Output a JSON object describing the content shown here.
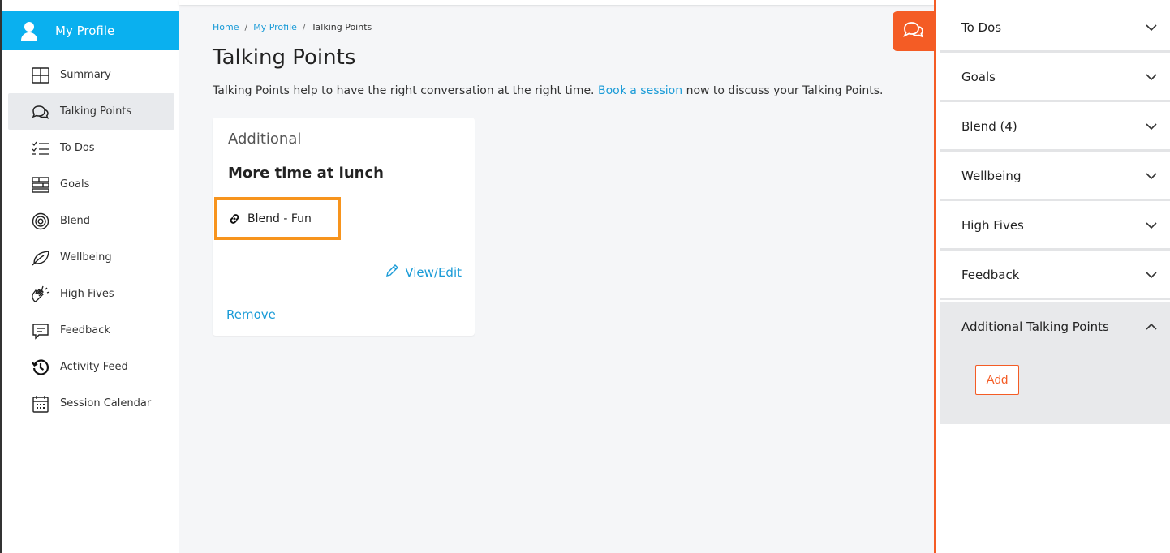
{
  "sidebar": {
    "profile_label": "My Profile",
    "items": [
      {
        "label": "Summary"
      },
      {
        "label": "Talking Points"
      },
      {
        "label": "To Dos"
      },
      {
        "label": "Goals"
      },
      {
        "label": "Blend"
      },
      {
        "label": "Wellbeing"
      },
      {
        "label": "High Fives"
      },
      {
        "label": "Feedback"
      },
      {
        "label": "Activity Feed"
      },
      {
        "label": "Session Calendar"
      }
    ],
    "active_item": "Talking Points"
  },
  "breadcrumb": {
    "home": "Home",
    "sep1": "/",
    "profile": "My Profile",
    "sep2": "/",
    "current": "Talking Points"
  },
  "main": {
    "title": "Talking Points",
    "intro_before": "Talking Points help to have the right conversation at the right time.",
    "intro_link": "Book a session",
    "intro_after": "now to discuss your Talking Points."
  },
  "card": {
    "category": "Additional",
    "title": "More time at lunch",
    "link_label": "Blend - Fun",
    "view_edit": "View/Edit",
    "remove": "Remove"
  },
  "rpanel": {
    "sections": [
      {
        "label": "To Dos"
      },
      {
        "label": "Goals"
      },
      {
        "label": "Blend (4)"
      },
      {
        "label": "Wellbeing"
      },
      {
        "label": "High Fives"
      },
      {
        "label": "Feedback"
      },
      {
        "label": "Additional Talking Points"
      }
    ],
    "add_label": "Add"
  },
  "colors": {
    "accent_blue": "#0ab0ef",
    "link_blue": "#1a9bd7",
    "orange": "#f45c25",
    "highlight": "#f7941d"
  }
}
